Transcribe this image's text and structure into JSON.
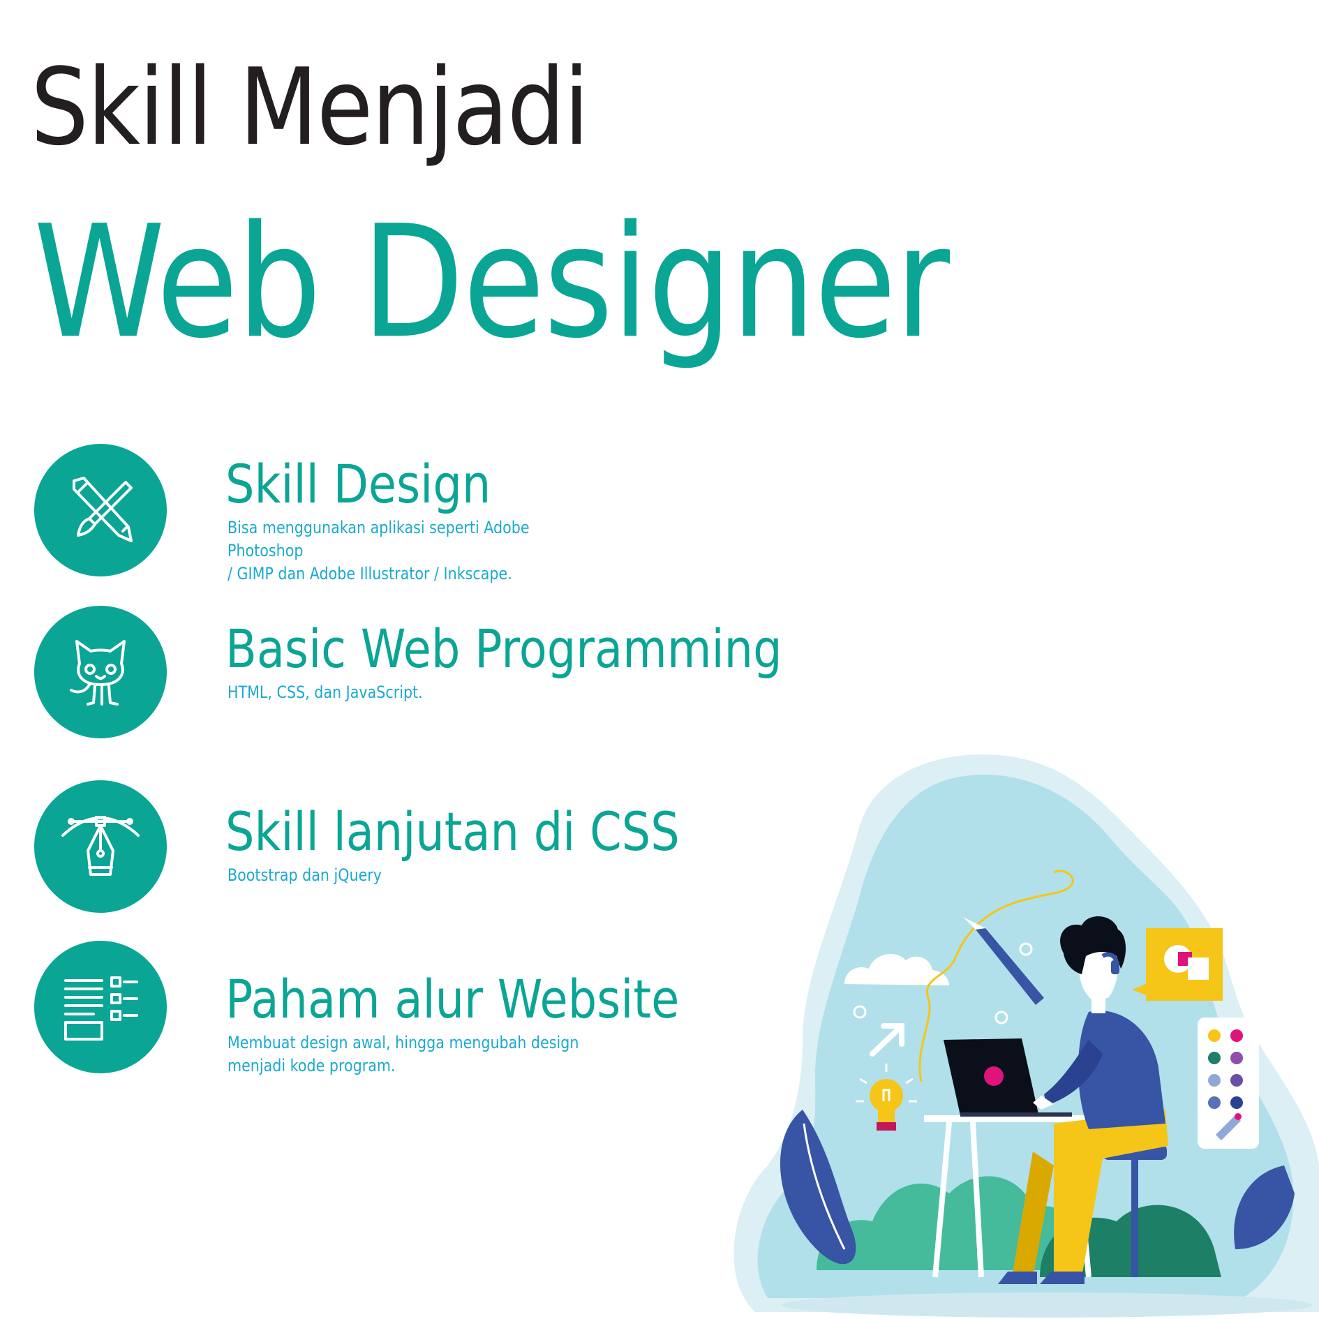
{
  "header": {
    "line1": "Skill Menjadi",
    "line2": "Web Designer"
  },
  "skills": [
    {
      "title": "Skill Design",
      "description": "Bisa menggunakan aplikasi seperti Adobe Photoshop\n/ GIMP dan Adobe Illustrator / Inkscape.",
      "icon": "pen-and-brush-icon"
    },
    {
      "title": "Basic Web Programming",
      "description": "HTML, CSS, dan JavaScript.",
      "icon": "octocat-icon"
    },
    {
      "title": "Skill lanjutan di CSS",
      "description": "Bootstrap dan jQuery",
      "icon": "bezier-pen-tool-icon"
    },
    {
      "title": "Paham alur Website",
      "description": "Membuat design awal, hingga mengubah design menjadi kode program.",
      "icon": "wireframe-layout-icon"
    }
  ],
  "colors": {
    "accent": "#0aa595",
    "heading_dark": "#231f20",
    "description": "#1aa9cf",
    "illustration_bg": "#b1e0ea"
  }
}
